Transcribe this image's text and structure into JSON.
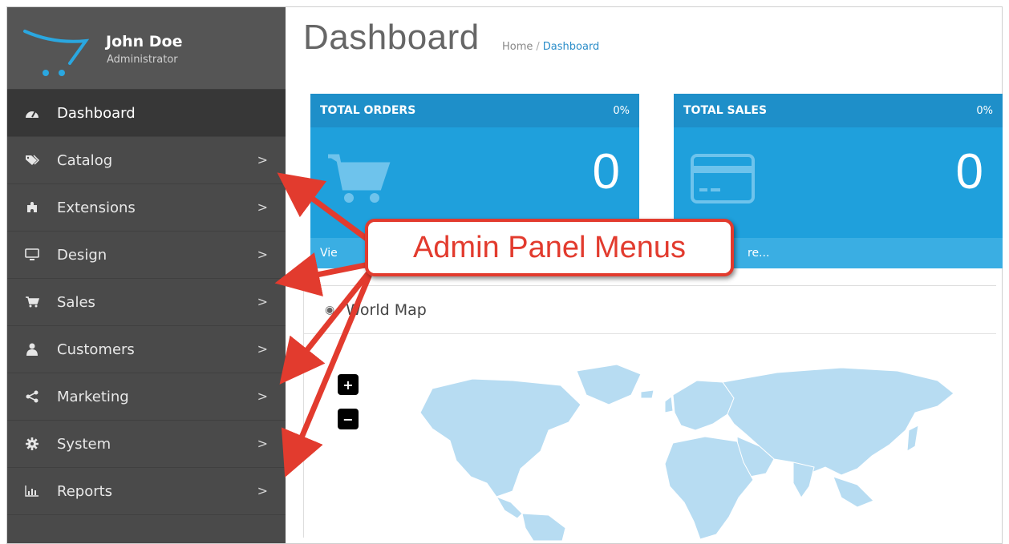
{
  "user": {
    "name": "John Doe",
    "role": "Administrator"
  },
  "sidebar": {
    "items": [
      {
        "label": "Dashboard",
        "icon": "dashboard-icon",
        "active": true,
        "has_children": false
      },
      {
        "label": "Catalog",
        "icon": "tags-icon",
        "has_children": true
      },
      {
        "label": "Extensions",
        "icon": "puzzle-icon",
        "has_children": true
      },
      {
        "label": "Design",
        "icon": "monitor-icon",
        "has_children": true
      },
      {
        "label": "Sales",
        "icon": "cart-icon",
        "has_children": true
      },
      {
        "label": "Customers",
        "icon": "user-icon",
        "has_children": true
      },
      {
        "label": "Marketing",
        "icon": "share-icon",
        "has_children": true
      },
      {
        "label": "System",
        "icon": "gear-icon",
        "has_children": true
      },
      {
        "label": "Reports",
        "icon": "bar-chart-icon",
        "has_children": true
      }
    ],
    "chevron": ">"
  },
  "header": {
    "title": "Dashboard",
    "breadcrumb": {
      "home": "Home",
      "separator": "/",
      "current": "Dashboard"
    }
  },
  "tiles": [
    {
      "title": "TOTAL ORDERS",
      "percent": "0%",
      "value": "0",
      "footer": "Vie",
      "icon": "cart-icon"
    },
    {
      "title": "TOTAL SALES",
      "percent": "0%",
      "value": "0",
      "footer": "re...",
      "icon": "credit-card-icon"
    }
  ],
  "map": {
    "title": "World Map",
    "zoom_in": "+",
    "zoom_out": "−"
  },
  "callout": {
    "text": "Admin Panel Menus"
  },
  "colors": {
    "sidebar_bg": "#4a4a4a",
    "tile_blue": "#1fa0dc",
    "callout_red": "#e23b2e",
    "map_land": "#b7dcf2"
  }
}
